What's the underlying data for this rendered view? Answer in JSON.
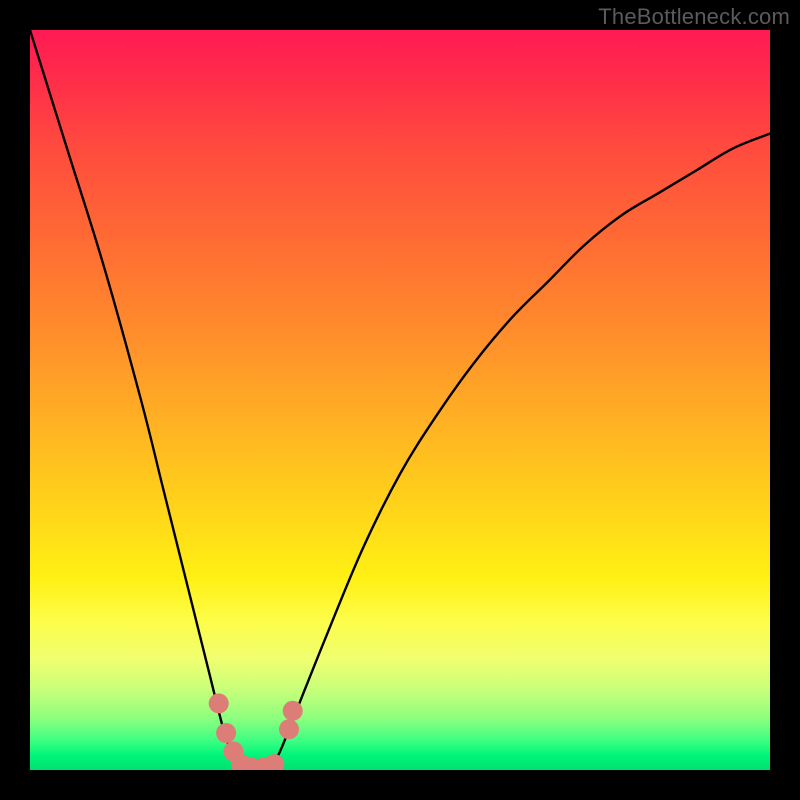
{
  "watermark": "TheBottleneck.com",
  "chart_data": {
    "type": "line",
    "title": "",
    "xlabel": "",
    "ylabel": "",
    "xlim": [
      0,
      100
    ],
    "ylim": [
      0,
      100
    ],
    "grid": false,
    "legend": false,
    "series": [
      {
        "name": "bottleneck-curve",
        "x": [
          0,
          5,
          10,
          15,
          18,
          21,
          24,
          26,
          27,
          28,
          29,
          30,
          31,
          32,
          33,
          34,
          36,
          40,
          45,
          50,
          55,
          60,
          65,
          70,
          75,
          80,
          85,
          90,
          95,
          100
        ],
        "values": [
          100,
          84,
          68,
          50,
          38,
          26,
          14,
          6,
          3,
          1,
          0,
          0,
          0,
          0,
          1,
          3,
          8,
          18,
          30,
          40,
          48,
          55,
          61,
          66,
          71,
          75,
          78,
          81,
          84,
          86
        ]
      }
    ],
    "markers": {
      "name": "highlight-dots",
      "color": "#dd7d78",
      "points": [
        {
          "x": 25.5,
          "y": 9
        },
        {
          "x": 26.5,
          "y": 5
        },
        {
          "x": 27.5,
          "y": 2.5
        },
        {
          "x": 28.5,
          "y": 0.8
        },
        {
          "x": 30.0,
          "y": 0.3
        },
        {
          "x": 31.5,
          "y": 0.3
        },
        {
          "x": 33.0,
          "y": 0.8
        },
        {
          "x": 35.0,
          "y": 5.5
        },
        {
          "x": 35.5,
          "y": 8
        }
      ]
    },
    "background_gradient": {
      "direction": "vertical",
      "stops": [
        {
          "pos": 0.0,
          "color": "#ff1a54"
        },
        {
          "pos": 0.28,
          "color": "#ff6a34"
        },
        {
          "pos": 0.52,
          "color": "#ffae24"
        },
        {
          "pos": 0.74,
          "color": "#fff014"
        },
        {
          "pos": 0.89,
          "color": "#c9ff7a"
        },
        {
          "pos": 1.0,
          "color": "#00e070"
        }
      ]
    }
  }
}
